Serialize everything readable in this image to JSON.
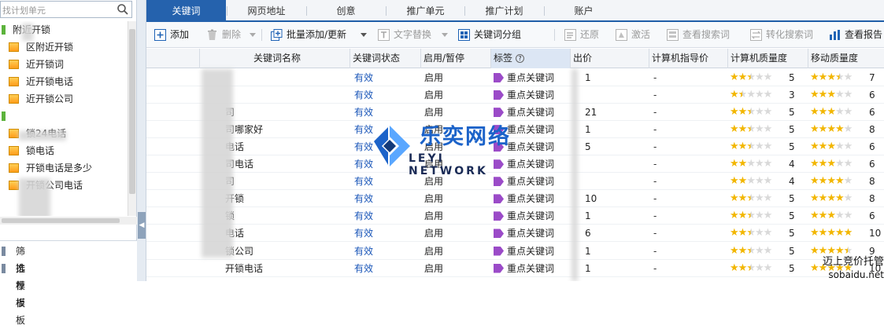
{
  "left_panel": {
    "search_placeholder": "找计划单元",
    "tree": [
      {
        "type": "group",
        "label": "附近开锁"
      },
      {
        "type": "unit",
        "label": "区附近开锁"
      },
      {
        "type": "unit",
        "label": "近开锁词"
      },
      {
        "type": "unit",
        "label": "近开锁电话"
      },
      {
        "type": "unit",
        "label": "近开锁公司"
      },
      {
        "type": "group",
        "label": ""
      },
      {
        "type": "unit",
        "label": "锁24电话"
      },
      {
        "type": "unit",
        "label": "锁电话"
      },
      {
        "type": "unit",
        "label": "开锁电话是多少"
      },
      {
        "type": "unit",
        "label": "开锁公司电话"
      }
    ],
    "templates": [
      {
        "label": "筛选模板"
      },
      {
        "label": "推荐模板"
      }
    ]
  },
  "tabs": [
    {
      "label": "关键词",
      "active": true
    },
    {
      "label": "网页地址",
      "active": false
    },
    {
      "label": "创意",
      "active": false
    },
    {
      "label": "推广单元",
      "active": false
    },
    {
      "label": "推广计划",
      "active": false
    },
    {
      "label": "账户",
      "active": false
    }
  ],
  "toolbar": {
    "add": "添加",
    "delete": "删除",
    "bulk_add": "批量添加/更新",
    "text_replace": "文字替换",
    "keyword_group": "关键词分组",
    "restore": "还原",
    "activate": "激活",
    "view_search_terms": "查看搜索词",
    "convert_search_terms": "转化搜索词",
    "view_report": "查看报告"
  },
  "grid": {
    "columns": {
      "keyword": "关键词名称",
      "status": "关键词状态",
      "enabled": "启用/暂停",
      "tag": "标签",
      "bid": "出价",
      "pc_guide": "计算机指导价",
      "pc_quality": "计算机质量度",
      "mobile_quality": "移动质量度"
    },
    "rows": [
      {
        "keyword": "",
        "status": "有效",
        "enabled": "启用",
        "tag": "重点关键词",
        "bid": "1",
        "pc_guide": "-",
        "pc_q": 5,
        "pc_stars": 2.5,
        "mob_q": 7,
        "mob_stars": 3.5
      },
      {
        "keyword": "",
        "status": "有效",
        "enabled": "启用",
        "tag": "重点关键词",
        "bid": "",
        "pc_guide": "-",
        "pc_q": 3,
        "pc_stars": 1.5,
        "mob_q": 6,
        "mob_stars": 3
      },
      {
        "keyword": "司",
        "status": "有效",
        "enabled": "启用",
        "tag": "重点关键词",
        "bid": "21",
        "pc_guide": "-",
        "pc_q": 5,
        "pc_stars": 2.5,
        "mob_q": 6,
        "mob_stars": 3
      },
      {
        "keyword": "司哪家好",
        "status": "有效",
        "enabled": "启用",
        "tag": "重点关键词",
        "bid": "1",
        "pc_guide": "-",
        "pc_q": 5,
        "pc_stars": 2.5,
        "mob_q": 8,
        "mob_stars": 4
      },
      {
        "keyword": "电话",
        "status": "有效",
        "enabled": "启用",
        "tag": "重点关键词",
        "bid": "5",
        "pc_guide": "-",
        "pc_q": 5,
        "pc_stars": 2.5,
        "mob_q": 6,
        "mob_stars": 3
      },
      {
        "keyword": "司电话",
        "status": "有效",
        "enabled": "启用",
        "tag": "重点关键词",
        "bid": "",
        "pc_guide": "-",
        "pc_q": 4,
        "pc_stars": 2,
        "mob_q": 6,
        "mob_stars": 3
      },
      {
        "keyword": "司",
        "status": "有效",
        "enabled": "启用",
        "tag": "重点关键词",
        "bid": "",
        "pc_guide": "-",
        "pc_q": 4,
        "pc_stars": 2,
        "mob_q": 8,
        "mob_stars": 4
      },
      {
        "keyword": "开锁",
        "status": "有效",
        "enabled": "启用",
        "tag": "重点关键词",
        "bid": "10",
        "pc_guide": "-",
        "pc_q": 5,
        "pc_stars": 2.5,
        "mob_q": 8,
        "mob_stars": 4
      },
      {
        "keyword": "锁",
        "status": "有效",
        "enabled": "启用",
        "tag": "重点关键词",
        "bid": "1",
        "pc_guide": "-",
        "pc_q": 5,
        "pc_stars": 2.5,
        "mob_q": 6,
        "mob_stars": 3
      },
      {
        "keyword": "电话",
        "status": "有效",
        "enabled": "启用",
        "tag": "重点关键词",
        "bid": "6",
        "pc_guide": "-",
        "pc_q": 5,
        "pc_stars": 2.5,
        "mob_q": 10,
        "mob_stars": 5
      },
      {
        "keyword": "锁公司",
        "status": "有效",
        "enabled": "启用",
        "tag": "重点关键词",
        "bid": "1",
        "pc_guide": "-",
        "pc_q": 5,
        "pc_stars": 2.5,
        "mob_q": 9,
        "mob_stars": 4.5
      },
      {
        "keyword": "开锁电话",
        "status": "有效",
        "enabled": "启用",
        "tag": "重点关键词",
        "bid": "1",
        "pc_guide": "-",
        "pc_q": 5,
        "pc_stars": 2.5,
        "mob_q": 10,
        "mob_stars": 5
      }
    ]
  },
  "logo": {
    "cn": "乐奕网络",
    "en": "LEYI NETWORK"
  },
  "watermark": {
    "line1": "迈上竞价托管",
    "line2": "sobaidu.net"
  },
  "colors": {
    "accent": "#2562ad",
    "status": "#1a56b8",
    "star": "#f2b600",
    "tag": "#9b4bc8"
  }
}
